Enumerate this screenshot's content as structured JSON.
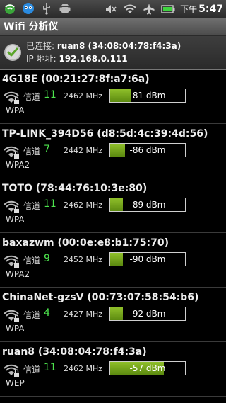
{
  "status": {
    "ampm": "下午",
    "time": "5:47"
  },
  "app": {
    "title": "Wifi 分析仪"
  },
  "connection": {
    "connected_label": "已连接: ",
    "connected_value": "ruan8 (34:08:04:78:f4:3a)",
    "ip_label": "IP 地址: ",
    "ip_value": "192.168.0.111"
  },
  "channel_label": "信道",
  "networks": [
    {
      "ssid": "4G18E (00:21:27:8f:a7:6a)",
      "channel": "11",
      "freq": "2462 MHz",
      "signal": "-81 dBm",
      "level": 0.28,
      "security": "WPA"
    },
    {
      "ssid": "TP-LINK_394D56 (d8:5d:4c:39:4d:56)",
      "channel": "7",
      "freq": "2442 MHz",
      "signal": "-86 dBm",
      "level": 0.2,
      "security": "WPA2"
    },
    {
      "ssid": "TOTO (78:44:76:10:3e:80)",
      "channel": "11",
      "freq": "2462 MHz",
      "signal": "-89 dBm",
      "level": 0.17,
      "security": "WPA"
    },
    {
      "ssid": "baxazwm (00:0e:e8:b1:75:70)",
      "channel": "9",
      "freq": "2452 MHz",
      "signal": "-90 dBm",
      "level": 0.17,
      "security": "WPA2"
    },
    {
      "ssid": "ChinaNet-gzsV (00:73:07:58:54:b6)",
      "channel": "4",
      "freq": "2427 MHz",
      "signal": "-92 dBm",
      "level": 0.17,
      "security": "WPA"
    },
    {
      "ssid": "ruan8 (34:08:04:78:f4:3a)",
      "channel": "11",
      "freq": "2462 MHz",
      "signal": "-57 dBm",
      "level": 0.72,
      "security": "WEP"
    }
  ]
}
